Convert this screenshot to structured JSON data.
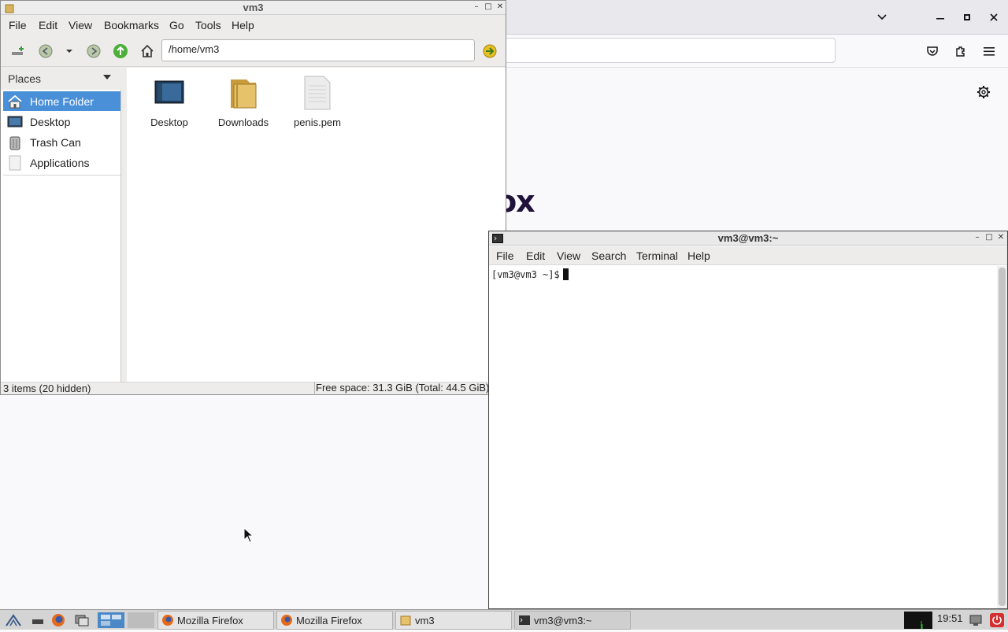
{
  "firefox": {
    "brand_text": "irefox",
    "colors": {
      "tabstrip": "#e8e8ed",
      "brand": "#20123a"
    },
    "icons": [
      "list-all-tabs-icon",
      "minimize-icon",
      "maximize-icon",
      "close-icon",
      "pocket-icon",
      "extensions-icon",
      "menu-icon",
      "settings-gear-icon"
    ]
  },
  "file_manager": {
    "title": "vm3",
    "menu": [
      "File",
      "Edit",
      "View",
      "Bookmarks",
      "Go",
      "Tools",
      "Help"
    ],
    "path": "/home/vm3",
    "places_label": "Places",
    "places": [
      {
        "label": "Home Folder",
        "icon": "home-icon",
        "selected": true
      },
      {
        "label": "Desktop",
        "icon": "desktop-icon",
        "selected": false
      },
      {
        "label": "Trash Can",
        "icon": "trash-icon",
        "selected": false
      },
      {
        "label": "Applications",
        "icon": "applications-icon",
        "selected": false
      }
    ],
    "files": [
      {
        "name": "Desktop",
        "icon": "desktop-folder-icon"
      },
      {
        "name": "Downloads",
        "icon": "folder-icon"
      },
      {
        "name": "penis.pem",
        "icon": "text-file-icon"
      }
    ],
    "status_left": "3 items (20 hidden)",
    "status_right": "Free space: 31.3 GiB (Total: 44.5 GiB)",
    "selection_color": "#4a90d9"
  },
  "terminal": {
    "title": "vm3@vm3:~",
    "menu": [
      "File",
      "Edit",
      "View",
      "Search",
      "Terminal",
      "Help"
    ],
    "prompt": "[vm3@vm3 ~]$"
  },
  "taskbar": {
    "tasks": [
      {
        "label": "Mozilla Firefox",
        "icon": "firefox-icon"
      },
      {
        "label": "Mozilla Firefox",
        "icon": "firefox-icon"
      },
      {
        "label": "vm3",
        "icon": "folder-icon"
      },
      {
        "label": "vm3@vm3:~",
        "icon": "terminal-icon"
      }
    ],
    "clock": "19:51"
  }
}
